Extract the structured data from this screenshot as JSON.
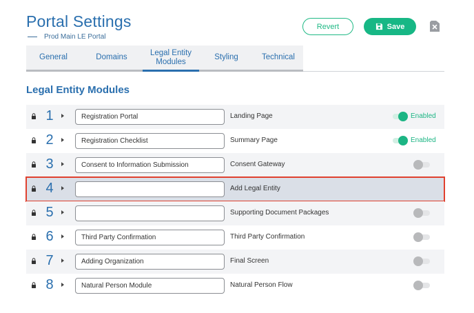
{
  "header": {
    "title": "Portal Settings",
    "subtitle": "Prod Main LE Portal"
  },
  "actions": {
    "revert_label": "Revert",
    "save_label": "Save"
  },
  "tabs": [
    {
      "label": "General"
    },
    {
      "label": "Domains"
    },
    {
      "label": "Legal Entity\nModules",
      "active": true
    },
    {
      "label": "Styling"
    },
    {
      "label": "Technical"
    }
  ],
  "section": {
    "title": "Legal Entity Modules"
  },
  "modules": [
    {
      "number": "1",
      "name": "Registration Portal",
      "description": "Landing Page",
      "toggle": "on",
      "status": "Enabled"
    },
    {
      "number": "2",
      "name": "Registration Checklist",
      "description": "Summary Page",
      "toggle": "on",
      "status": "Enabled"
    },
    {
      "number": "3",
      "name": "Consent to Information Submission",
      "description": "Consent Gateway",
      "toggle": "off",
      "status": ""
    },
    {
      "number": "4",
      "name": "",
      "description": "Add Legal Entity",
      "toggle": "none",
      "status": ""
    },
    {
      "number": "5",
      "name": "",
      "description": "Supporting Document Packages",
      "toggle": "off",
      "status": ""
    },
    {
      "number": "6",
      "name": "Third Party Confirmation",
      "description": "Third Party Confirmation",
      "toggle": "off",
      "status": ""
    },
    {
      "number": "7",
      "name": "Adding Organization",
      "description": "Final Screen",
      "toggle": "off",
      "status": ""
    },
    {
      "number": "8",
      "name": "Natural Person Module",
      "description": "Natural Person Flow",
      "toggle": "off",
      "status": ""
    }
  ],
  "colors": {
    "primary_blue": "#2a6fae",
    "accent_green": "#17b785",
    "selection_outline": "#e0402e"
  }
}
